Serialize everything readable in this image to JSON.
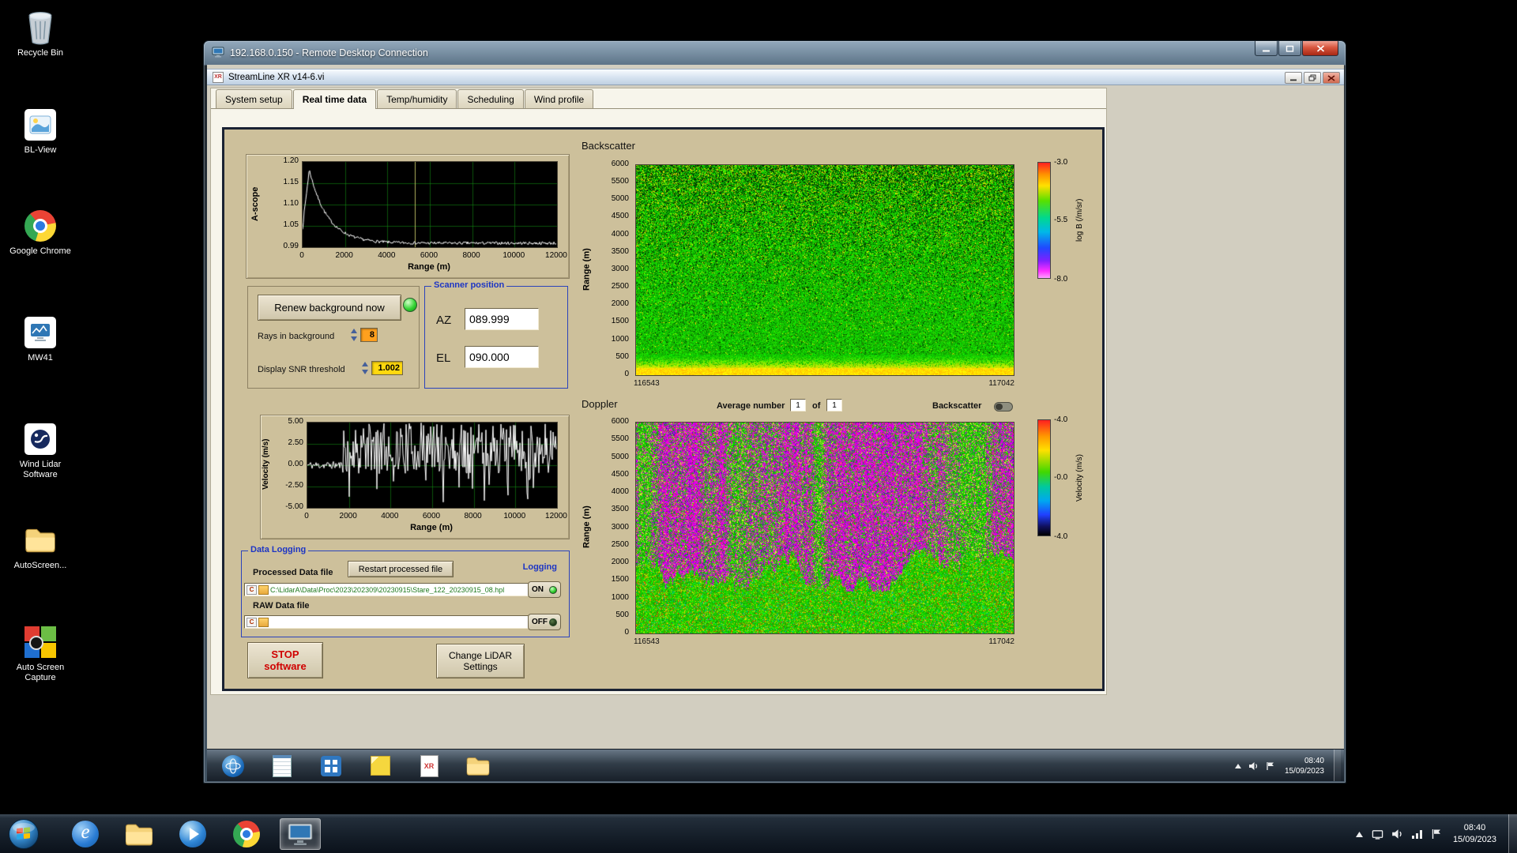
{
  "colors": {
    "panel_tan": "#cdc09b",
    "group_label_blue": "#1d35c4",
    "stop_red": "#d00000",
    "logging_on_green": "#2ecc2e",
    "path_text_green": "#1f7a1f"
  },
  "desktop": {
    "icons": [
      {
        "label": "Recycle Bin"
      },
      {
        "label": "BL-View"
      },
      {
        "label": "Google Chrome"
      },
      {
        "label": "MW41"
      },
      {
        "label": "Wind Lidar Software"
      },
      {
        "label": "AutoScreen..."
      },
      {
        "label": "Auto Screen Capture"
      }
    ]
  },
  "rdp_window": {
    "title": "192.168.0.150 - Remote Desktop Connection"
  },
  "app_window": {
    "title": "StreamLine XR v14-6.vi",
    "tabs": [
      {
        "label": "System setup"
      },
      {
        "label": "Real time data"
      },
      {
        "label": "Temp/humidity"
      },
      {
        "label": "Scheduling"
      },
      {
        "label": "Wind profile"
      }
    ],
    "active_tab": "Real time data"
  },
  "panel": {
    "background_box": {
      "renew_button": "Renew background now",
      "rays_label": "Rays in background",
      "rays_value": "8",
      "snr_label": "Display SNR threshold",
      "snr_value": "1.002"
    },
    "scanner_position": {
      "title": "Scanner position",
      "az_label": "AZ",
      "az_value": "089.999",
      "el_label": "EL",
      "el_value": "090.000"
    },
    "backscatter_title": "Backscatter",
    "doppler_title": "Doppler",
    "average_label": "Average number",
    "average_value": "1",
    "of_label": "of",
    "of_total": "1",
    "backscatter_toggle_label": "Backscatter",
    "data_logging": {
      "title": "Data Logging",
      "processed_label": "Processed Data file",
      "restart_button": "Restart processed file",
      "processed_path": "C:\\LidarA\\Data\\Proc\\2023\\202309\\20230915\\Stare_122_20230915_08.hpl",
      "logging_label": "Logging",
      "on_label": "ON",
      "raw_label": "RAW Data file",
      "raw_path": "",
      "off_label": "OFF",
      "drive_badge": "C"
    },
    "stop_button_line1": "STOP",
    "stop_button_line2": "software",
    "settings_button_line1": "Change LiDAR",
    "settings_button_line2": "Settings"
  },
  "chart_data": [
    {
      "id": "ascope",
      "type": "line",
      "ylabel": "A-scope",
      "xlabel": "Range (m)",
      "ylim": [
        0.99,
        1.2
      ],
      "xlim": [
        0,
        12000
      ],
      "yticks": [
        "1.20",
        "1.15",
        "1.10",
        "1.05",
        "0.99"
      ],
      "xticks": [
        "0",
        "2000",
        "4000",
        "6000",
        "8000",
        "10000",
        "12000"
      ],
      "series_note": "white background-noise trace: sharp peak ~1.18 near 300 m decaying to ~1.00, flat noisy tail to 12000 m; vertical cursor near 5200 m"
    },
    {
      "id": "backscatter",
      "type": "heatmap",
      "title": "Backscatter",
      "ylabel": "Range (m)",
      "ylim": [
        0,
        6000
      ],
      "yticks": [
        "6000",
        "5500",
        "5000",
        "4500",
        "4000",
        "3500",
        "3000",
        "2500",
        "2000",
        "1500",
        "1000",
        "500",
        "0"
      ],
      "xticks": [
        "116543",
        "117042"
      ],
      "colorbar_label": "log B (/m/sr)",
      "colorbar_ticks": [
        "-3.0",
        "-5.5",
        "-8.0"
      ],
      "description": "green speckled field, bright yellow band below ~500 m, increasing yellow/black speckle above ~3000 m"
    },
    {
      "id": "velocity",
      "type": "line",
      "ylabel": "Velocity (m/s)",
      "xlabel": "Range (m)",
      "ylim": [
        -5,
        5
      ],
      "xlim": [
        0,
        12000
      ],
      "yticks": [
        "5.00",
        "2.50",
        "0.00",
        "-2.50",
        "-5.00"
      ],
      "xticks": [
        "0",
        "2000",
        "4000",
        "6000",
        "8000",
        "10000",
        "12000"
      ],
      "series_note": "near-zero trace below ~2000 m, dense noise spikes spanning roughly -2 to +5 m/s beyond"
    },
    {
      "id": "doppler",
      "type": "heatmap",
      "title": "Doppler",
      "ylabel": "Range (m)",
      "ylim": [
        0,
        6000
      ],
      "yticks": [
        "6000",
        "5500",
        "5000",
        "4500",
        "4000",
        "3500",
        "3000",
        "2500",
        "2000",
        "1500",
        "1000",
        "500",
        "0"
      ],
      "xticks": [
        "116543",
        "117042"
      ],
      "colorbar_label": "Velocity (m/s)",
      "colorbar_ticks": [
        "-4.0",
        "-0.0",
        "-4.0"
      ],
      "description": "magenta/green noise columns above ~2500 m, coherent green-yellow field below"
    }
  ],
  "remote_taskbar": {
    "time": "08:40",
    "date": "15/09/2023"
  },
  "taskbar": {
    "time": "08:40",
    "date": "15/09/2023"
  }
}
